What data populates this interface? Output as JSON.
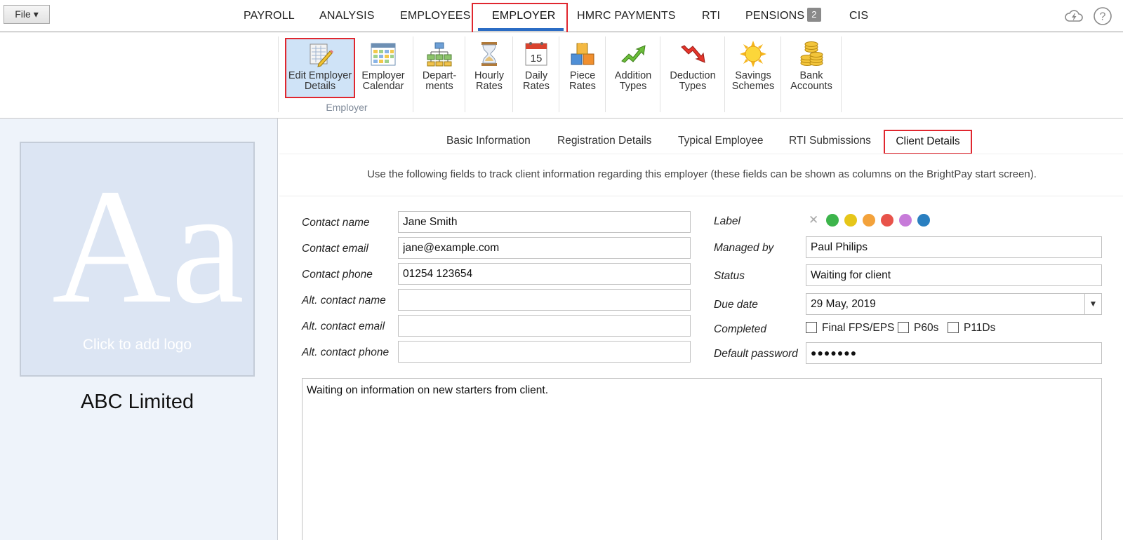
{
  "topbar": {
    "file_label": "File ▾",
    "tabs": [
      {
        "label": "PAYROLL"
      },
      {
        "label": "ANALYSIS"
      },
      {
        "label": "EMPLOYEES"
      },
      {
        "label": "EMPLOYER"
      },
      {
        "label": "HMRC PAYMENTS"
      },
      {
        "label": "RTI"
      },
      {
        "label": "PENSIONS",
        "badge": "2"
      },
      {
        "label": "CIS"
      }
    ],
    "active_tab": "EMPLOYER",
    "icons": [
      "cloud-bolt-icon",
      "help-icon"
    ]
  },
  "ribbon": {
    "group_label": "Employer",
    "buttons": [
      {
        "line1": "Edit Employer",
        "line2": "Details",
        "icon": "edit-employer-icon"
      },
      {
        "line1": "Employer",
        "line2": "Calendar",
        "icon": "calendar-grid-icon"
      },
      {
        "line1": "Depart-",
        "line2": "ments",
        "icon": "org-chart-icon"
      },
      {
        "line1": "Hourly",
        "line2": "Rates",
        "icon": "hourglass-icon"
      },
      {
        "line1": "Daily",
        "line2": "Rates",
        "icon": "calendar-day-icon",
        "icon_text": "15"
      },
      {
        "line1": "Piece",
        "line2": "Rates",
        "icon": "blocks-icon"
      },
      {
        "line1": "Addition",
        "line2": "Types",
        "icon": "arrow-up-icon"
      },
      {
        "line1": "Deduction",
        "line2": "Types",
        "icon": "arrow-down-icon"
      },
      {
        "line1": "Savings",
        "line2": "Schemes",
        "icon": "sun-icon"
      },
      {
        "line1": "Bank",
        "line2": "Accounts",
        "icon": "coins-icon"
      }
    ]
  },
  "left_panel": {
    "logo_glyph": "Aa",
    "logo_hint": "Click to add logo",
    "company_name": "ABC Limited"
  },
  "subtabs": {
    "items": [
      "Basic Information",
      "Registration Details",
      "Typical Employee",
      "RTI Submissions",
      "Client Details"
    ],
    "active": "Client Details"
  },
  "instruction": "Use the following fields to track client information regarding this employer (these fields can be shown as columns on the BrightPay start screen).",
  "form_left": {
    "contact_name": {
      "label": "Contact name",
      "value": "Jane Smith"
    },
    "contact_email": {
      "label": "Contact email",
      "value": "jane@example.com"
    },
    "contact_phone": {
      "label": "Contact phone",
      "value": "01254 123654"
    },
    "alt_contact_name": {
      "label": "Alt. contact name",
      "value": ""
    },
    "alt_contact_email": {
      "label": "Alt. contact email",
      "value": ""
    },
    "alt_contact_phone": {
      "label": "Alt. contact phone",
      "value": ""
    }
  },
  "form_right": {
    "label": {
      "label": "Label",
      "clear_glyph": "✕",
      "colors": [
        "#3cb44b",
        "#e6c619",
        "#f3a23b",
        "#e8534a",
        "#c77bd9",
        "#2a7fc0"
      ]
    },
    "managed_by": {
      "label": "Managed by",
      "value": "Paul Philips"
    },
    "status": {
      "label": "Status",
      "value": "Waiting for client"
    },
    "due_date": {
      "label": "Due date",
      "value": "29 May, 2019"
    },
    "completed": {
      "label": "Completed",
      "options": [
        {
          "label": "Final FPS/EPS",
          "checked": false
        },
        {
          "label": "P60s",
          "checked": false
        },
        {
          "label": "P11Ds",
          "checked": false
        }
      ]
    },
    "default_password": {
      "label": "Default password",
      "value": "●●●●●●●"
    }
  },
  "notes": "Waiting on information on new starters from client."
}
